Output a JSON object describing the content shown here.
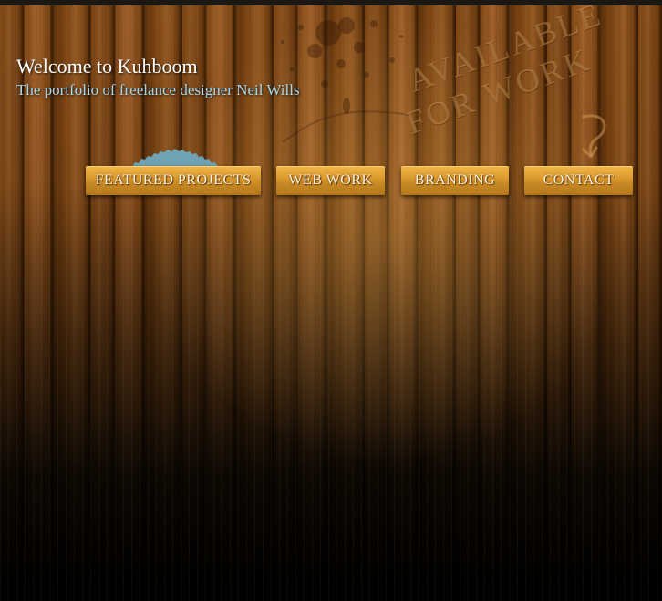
{
  "header": {
    "title": "Welcome to Kuhboom",
    "tagline": "The portfolio of freelance designer Neil Wills"
  },
  "availability": {
    "line1": "AVAILABLE",
    "line2": "FOR WORK"
  },
  "nav": {
    "items": [
      {
        "label": "FEATURED PROJECTS",
        "active": true
      },
      {
        "label": "WEB WORK",
        "active": false
      },
      {
        "label": "BRANDING",
        "active": false
      },
      {
        "label": "CONTACT",
        "active": false
      }
    ]
  },
  "colors": {
    "wood": "#7a4413",
    "button": "#dd9b2f",
    "tagline": "#a8d7ea",
    "indicator": "#6fa3b3"
  }
}
